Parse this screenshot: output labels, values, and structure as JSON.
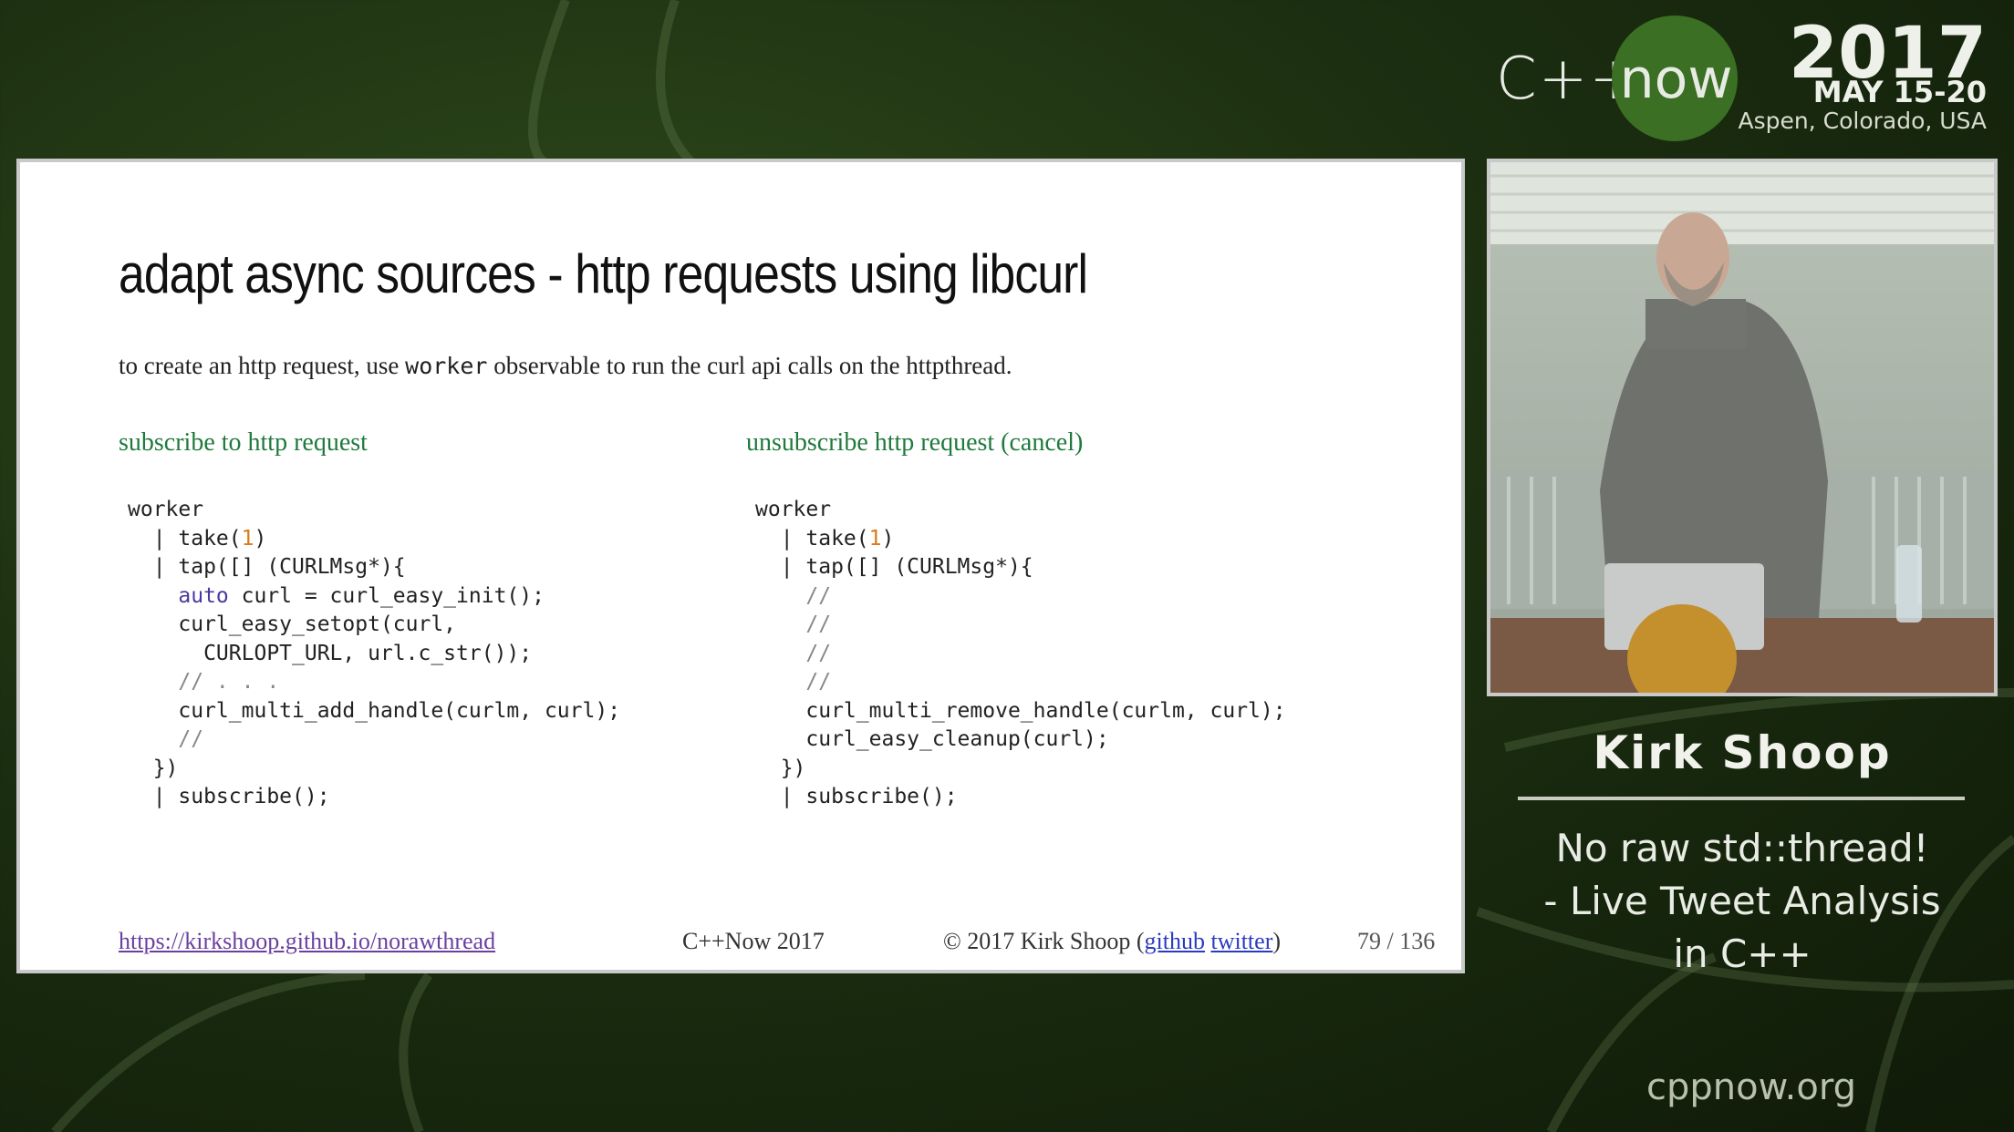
{
  "brand": {
    "cpp": "C++",
    "now": "now",
    "year": "2017",
    "dates": "MAY 15-20",
    "location": "Aspen, Colorado, USA"
  },
  "slide": {
    "title": "adapt async sources - http requests using libcurl",
    "intro_pre": "to create an http request, use ",
    "intro_code": "worker",
    "intro_post": " observable to run the curl api calls on the httpthread.",
    "left_heading": "subscribe to http request",
    "right_heading": "unsubscribe http request (cancel)",
    "left_code": [
      {
        "parts": [
          {
            "t": "worker",
            "k": "plain"
          }
        ]
      },
      {
        "parts": [
          {
            "t": "  | take(",
            "k": "plain"
          },
          {
            "t": "1",
            "k": "num"
          },
          {
            "t": ")",
            "k": "plain"
          }
        ]
      },
      {
        "parts": [
          {
            "t": "  | tap([] (CURLMsg*){",
            "k": "plain"
          }
        ]
      },
      {
        "parts": [
          {
            "t": "    ",
            "k": "plain"
          },
          {
            "t": "auto",
            "k": "kw"
          },
          {
            "t": " curl = curl_easy_init();",
            "k": "plain"
          }
        ]
      },
      {
        "parts": [
          {
            "t": "    curl_easy_setopt(curl,",
            "k": "plain"
          }
        ]
      },
      {
        "parts": [
          {
            "t": "      CURLOPT_URL, url.c_str());",
            "k": "plain"
          }
        ]
      },
      {
        "parts": [
          {
            "t": "    // . . .",
            "k": "cm"
          }
        ]
      },
      {
        "parts": [
          {
            "t": "    curl_multi_add_handle(curlm, curl);",
            "k": "plain"
          }
        ]
      },
      {
        "parts": [
          {
            "t": "    //",
            "k": "cm"
          }
        ]
      },
      {
        "parts": [
          {
            "t": "  })",
            "k": "plain"
          }
        ]
      },
      {
        "parts": [
          {
            "t": "  | subscribe();",
            "k": "plain"
          }
        ]
      }
    ],
    "right_code": [
      {
        "parts": [
          {
            "t": "worker",
            "k": "plain"
          }
        ]
      },
      {
        "parts": [
          {
            "t": "  | take(",
            "k": "plain"
          },
          {
            "t": "1",
            "k": "num"
          },
          {
            "t": ")",
            "k": "plain"
          }
        ]
      },
      {
        "parts": [
          {
            "t": "  | tap([] (CURLMsg*){",
            "k": "plain"
          }
        ]
      },
      {
        "parts": [
          {
            "t": "    //",
            "k": "cm"
          }
        ]
      },
      {
        "parts": [
          {
            "t": "    //",
            "k": "cm"
          }
        ]
      },
      {
        "parts": [
          {
            "t": "    //",
            "k": "cm"
          }
        ]
      },
      {
        "parts": [
          {
            "t": "    //",
            "k": "cm"
          }
        ]
      },
      {
        "parts": [
          {
            "t": "    curl_multi_remove_handle(curlm, curl);",
            "k": "plain"
          }
        ]
      },
      {
        "parts": [
          {
            "t": "    curl_easy_cleanup(curl);",
            "k": "plain"
          }
        ]
      },
      {
        "parts": [
          {
            "t": "  })",
            "k": "plain"
          }
        ]
      },
      {
        "parts": [
          {
            "t": "  | subscribe();",
            "k": "plain"
          }
        ]
      }
    ],
    "footer": {
      "url": "https://kirkshoop.github.io/norawthread",
      "event": "C++Now 2017",
      "copyright_pre": "© 2017 Kirk Shoop (",
      "github": "github",
      "twitter": "twitter",
      "copyright_post": ")",
      "page": "79 / 136"
    }
  },
  "speaker": {
    "name": "Kirk Shoop",
    "talk_line1": "No raw std::thread!",
    "talk_line2": "- Live Tweet Analysis",
    "talk_line3": "in C++"
  },
  "site": "cppnow.org",
  "colors": {
    "heading_green": "#1f7a3c",
    "brand_green": "#3b6f24",
    "keyword": "#4a3aa0",
    "number": "#d97b1a"
  }
}
